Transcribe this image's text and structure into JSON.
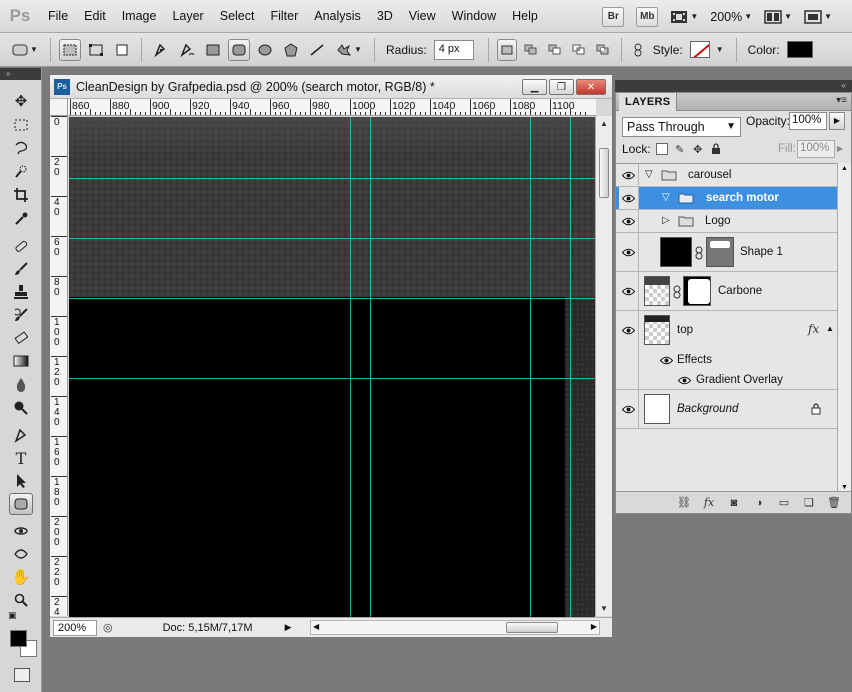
{
  "app": {
    "logo": "Ps"
  },
  "menu": [
    "File",
    "Edit",
    "Image",
    "Layer",
    "Select",
    "Filter",
    "Analysis",
    "3D",
    "View",
    "Window",
    "Help"
  ],
  "menu_right": {
    "bridge": "Br",
    "mini_bridge": "Mb",
    "zoom": "200%"
  },
  "options_bar": {
    "radius_label": "Radius:",
    "radius_value": "4 px",
    "style_label": "Style:",
    "color_label": "Color:",
    "color": "#000000"
  },
  "document": {
    "title": "CleanDesign by Grafpedia.psd @ 200% (search motor, RGB/8) *",
    "ps_icon": "Ps",
    "ruler_top": [
      "860",
      "880",
      "900",
      "920",
      "940",
      "960",
      "980",
      "1000",
      "1020",
      "1040",
      "1060",
      "1080",
      "1100"
    ],
    "ruler_left": [
      [
        "0"
      ],
      [
        "2",
        "0"
      ],
      [
        "4",
        "0"
      ],
      [
        "6",
        "0"
      ],
      [
        "8",
        "0"
      ],
      [
        "1",
        "0",
        "0"
      ],
      [
        "1",
        "2",
        "0"
      ],
      [
        "1",
        "4",
        "0"
      ],
      [
        "1",
        "6",
        "0"
      ],
      [
        "1",
        "8",
        "0"
      ],
      [
        "2",
        "0",
        "0"
      ],
      [
        "2",
        "2",
        "0"
      ],
      [
        "2",
        "4"
      ]
    ],
    "zoom": "200%",
    "doc_info": "Doc: 5,15M/7,17M"
  },
  "layers_panel": {
    "tab": "LAYERS",
    "blend_mode": "Pass Through",
    "opacity_label": "Opacity:",
    "opacity": "100%",
    "lock_label": "Lock:",
    "fill_label": "Fill:",
    "fill": "100%",
    "layers": [
      {
        "name": "carousel",
        "kind": "group"
      },
      {
        "name": "search motor",
        "kind": "group",
        "selected": true
      },
      {
        "name": "Logo",
        "kind": "group"
      },
      {
        "name": "Shape 1",
        "kind": "shape"
      },
      {
        "name": "Carbone",
        "kind": "masked"
      },
      {
        "name": "top",
        "kind": "pixel",
        "fx": "fx"
      },
      {
        "name": "Effects",
        "kind": "effects"
      },
      {
        "name": "Gradient Overlay",
        "kind": "effect"
      },
      {
        "name": "Background",
        "kind": "background"
      }
    ]
  },
  "colors": {
    "guide": "#22c9c9",
    "selection": "#3d8fe0",
    "canvas": "#000000",
    "canvas_texture": "#3a3a3a"
  }
}
